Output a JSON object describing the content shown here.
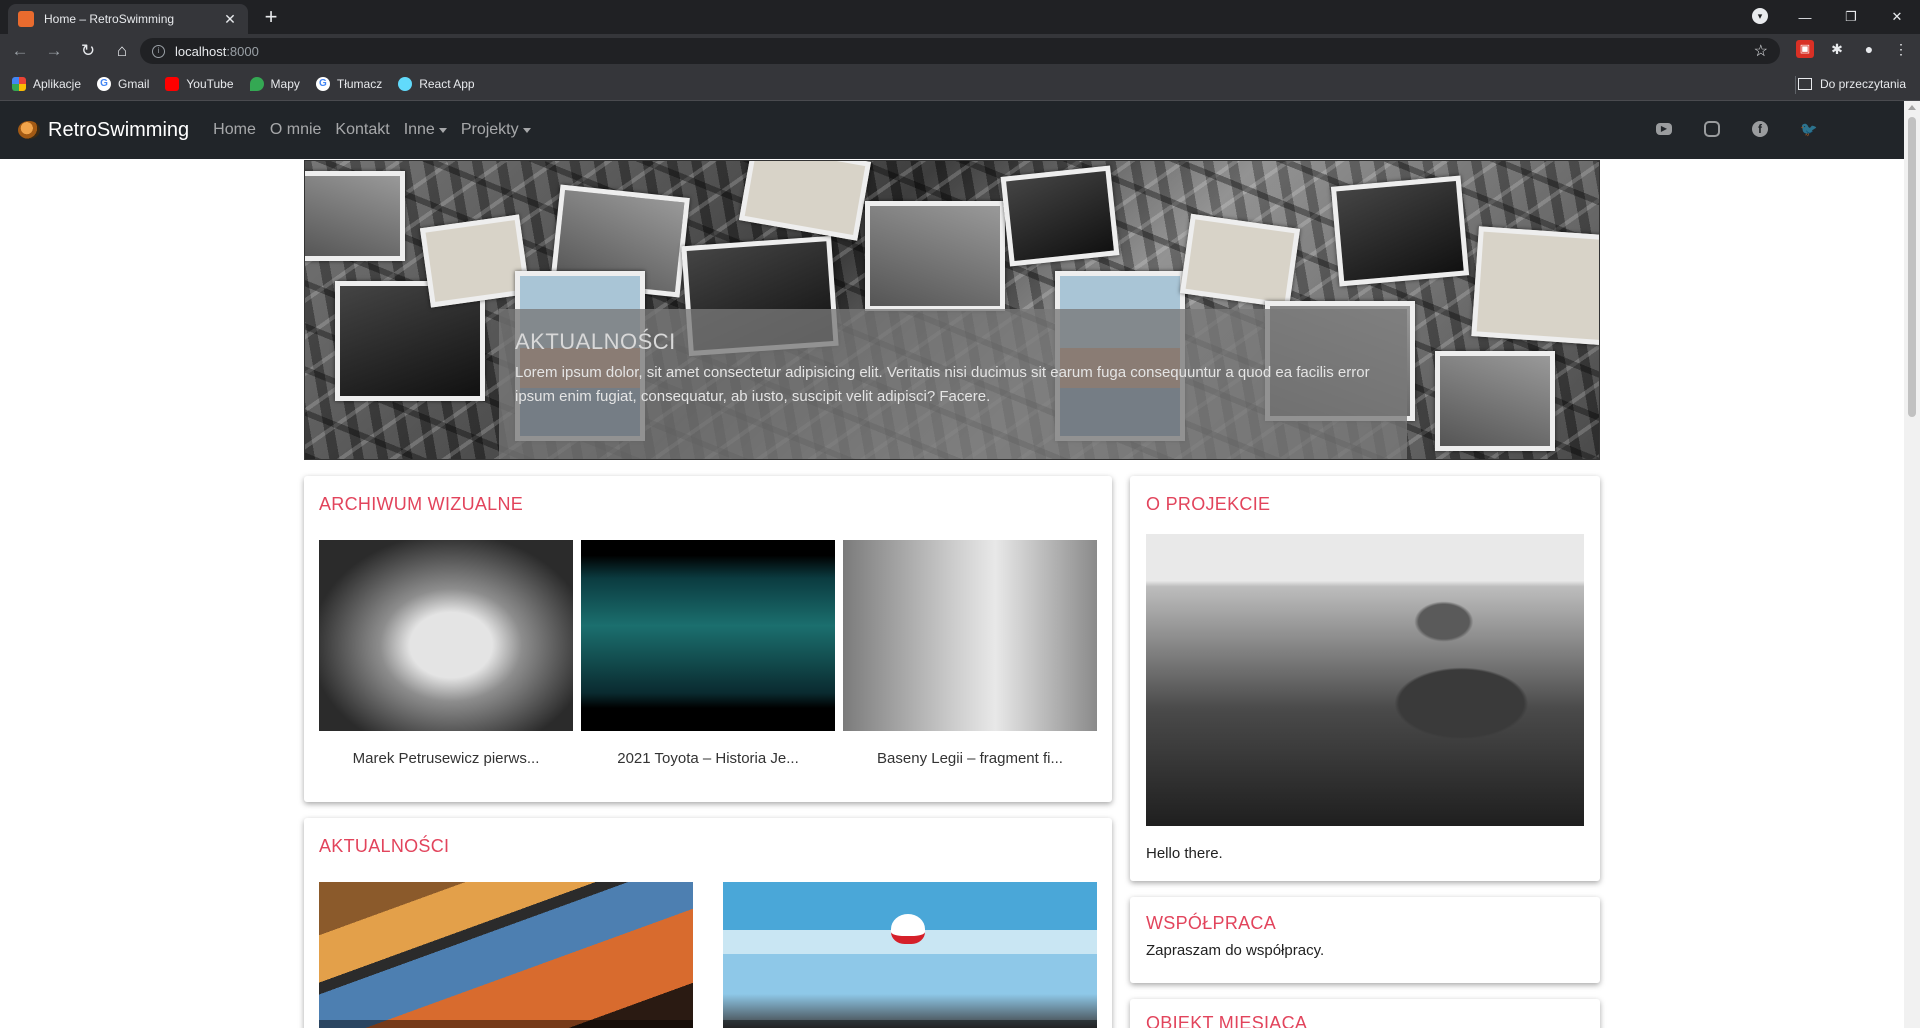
{
  "browser": {
    "tab_title": "Home – RetroSwimming",
    "tab_close": "✕",
    "new_tab": "+",
    "url_host": "localhost",
    "url_port": ":8000",
    "window_controls": [
      "—",
      "❐",
      "✕"
    ],
    "bookmarks": [
      {
        "label": "Aplikacje",
        "icon": "apps-grid-icon"
      },
      {
        "label": "Gmail",
        "icon": "google-icon"
      },
      {
        "label": "YouTube",
        "icon": "youtube-icon"
      },
      {
        "label": "Mapy",
        "icon": "maps-icon"
      },
      {
        "label": "Tłumacz",
        "icon": "google-icon"
      },
      {
        "label": "React App",
        "icon": "react-icon"
      }
    ],
    "reading_list": "Do przeczytania"
  },
  "site": {
    "brand": "RetroSwimming",
    "nav": [
      {
        "label": "Home",
        "dropdown": false
      },
      {
        "label": "O mnie",
        "dropdown": false
      },
      {
        "label": "Kontakt",
        "dropdown": false
      },
      {
        "label": "Inne",
        "dropdown": true
      },
      {
        "label": "Projekty",
        "dropdown": true
      }
    ],
    "social_icons": [
      "youtube-icon",
      "instagram-icon",
      "facebook-icon",
      "twitter-icon"
    ]
  },
  "hero": {
    "title": "AKTUALNOŚCI",
    "text": "Lorem ipsum dolor, sit amet consectetur adipisicing elit. Veritatis nisi ducimus sit earum fuga consequuntur a quod ea facilis error ipsum enim fugiat, consequatur, ab iusto, suscipit velit adipisci? Facere."
  },
  "archive": {
    "title": "ARCHIWUM WIZUALNE",
    "videos": [
      {
        "label": "Marek Petrusewicz pierws..."
      },
      {
        "label": "2021 Toyota – Historia Je..."
      },
      {
        "label": "Baseny Legii – fragment fi..."
      }
    ]
  },
  "news": {
    "title": "AKTUALNOŚCI"
  },
  "project": {
    "title": "O PROJEKCIE",
    "text": "Hello there."
  },
  "cooperation": {
    "title": "WSPÓŁPRACA",
    "text": "Zapraszam do współpracy."
  },
  "object": {
    "title": "OBIEKT MIESIĄCA"
  },
  "colors": {
    "accent": "#e2445c",
    "navbar": "#212529"
  }
}
